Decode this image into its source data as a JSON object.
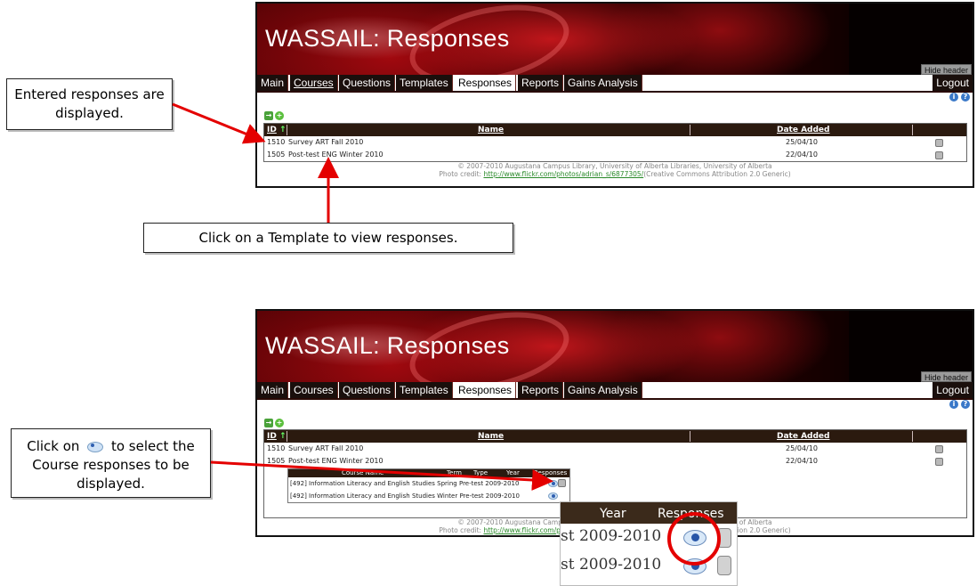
{
  "app": {
    "header_title": "WASSAIL: Responses",
    "hide_header_label": "Hide header",
    "logout_label": "Logout"
  },
  "tabs": [
    "Main",
    "Courses",
    "Questions",
    "Templates",
    "Responses",
    "Reports",
    "Gains Analysis"
  ],
  "active_tab": "Responses",
  "table": {
    "headers": {
      "id": "ID",
      "name": "Name",
      "date_added": "Date Added"
    },
    "rows": [
      {
        "id": "1510",
        "name": "Survey ART Fall 2010",
        "date": "25/04/10"
      },
      {
        "id": "1505",
        "name": "Post-test ENG Winter 2010",
        "date": "22/04/10"
      }
    ]
  },
  "footer": {
    "copyright": "© 2007-2010 Augustana Campus Library, University of Alberta Libraries, University of Alberta",
    "photo_credit_prefix": "Photo credit:",
    "photo_link": "http://www.flickr.com/photos/adrian_s/6877305/",
    "photo_credit_suffix": "(Creative Commons Attribution 2.0 Generic)"
  },
  "course_table": {
    "headers": {
      "course_name": "Course Name",
      "term": "Term",
      "type": "Type",
      "year": "Year",
      "responses": "Responses"
    },
    "rows": [
      "[492] Information Literacy and English Studies Spring Pre-test 2009-2010",
      "[492] Information Literacy and English Studies Winter Pre-test 2009-2010"
    ]
  },
  "zoom": {
    "year_header": "Year",
    "responses_header": "Responses",
    "row1": "st 2009-2010",
    "row2": "st 2009-2010"
  },
  "callouts": {
    "entered": "Entered responses are displayed.",
    "template": "Click on a Template to view responses.",
    "click_on": "Click on",
    "click_rest": "to select the Course responses to be displayed."
  },
  "colors": {
    "header_bg": "#050000",
    "tab_bg": "#1a0f0c",
    "table_head": "#2b1a0f",
    "arrow": "#e40000",
    "link": "#2a8a2a"
  }
}
